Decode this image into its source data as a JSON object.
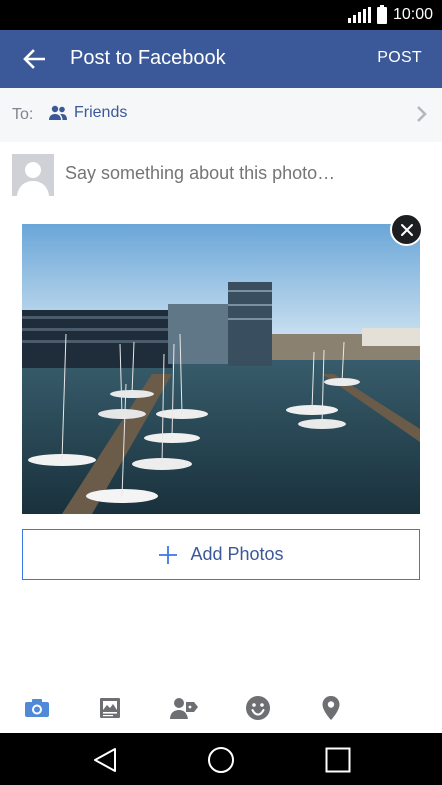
{
  "status_bar": {
    "time": "10:00"
  },
  "app_bar": {
    "title": "Post to Facebook",
    "post_label": "POST"
  },
  "audience": {
    "to_label": "To:",
    "value": "Friends"
  },
  "composer": {
    "placeholder": "Say something about this photo…"
  },
  "actions": {
    "add_photos_label": "Add Photos"
  },
  "toolbar": {
    "items": [
      "camera-icon",
      "photo-album-icon",
      "tag-people-icon",
      "feeling-icon",
      "location-icon"
    ]
  },
  "colors": {
    "brand": "#3b5998",
    "accent": "#3b78e7",
    "to_row_bg": "#f6f7f9",
    "toolbar_icon": "#6d6f73",
    "toolbar_active": "#4f89d8"
  }
}
